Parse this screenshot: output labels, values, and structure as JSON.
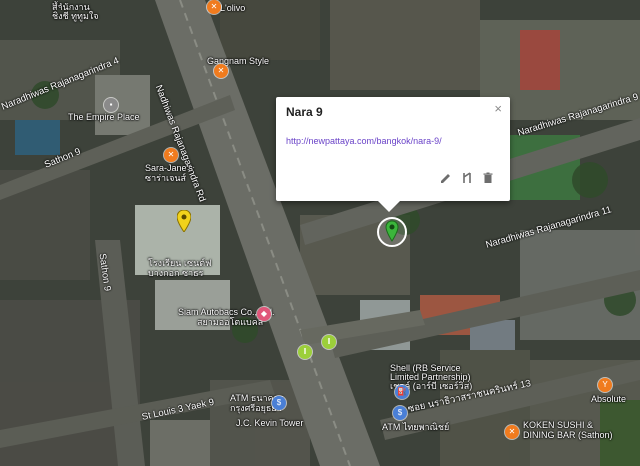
{
  "popup": {
    "title": "Nara 9",
    "link": "http://newpattaya.com/bangkok/nara-9/",
    "close": "×"
  },
  "roads": {
    "naradhiwas_main": "Nadhiwas Rajanagarindra Rd",
    "naradhiwas_4": "Naradhiwas Rajanagarindra 4",
    "naradhiwas_11": "Naradhiwas Rajanagarindra 11",
    "naradhiwas_alley": "Naradhiwas Rajanagarindra 9 Alley",
    "sathon_9": "Sathon 9",
    "soi_9": "Sathon 9",
    "st_louis": "St Louis 3 Yaek 9",
    "thai_road": "ซอย นราธิวาสราชนครินทร์ 13"
  },
  "labels": {
    "top_left_thai_1": "มัง",
    "top_left_thai_2": "สำนักงาน",
    "top_left_thai_3": "ชิงชี ทูทูมใจ",
    "lolivo": "L'olivo",
    "gangnam": "Gangnam Style",
    "empire": "The Empire Place",
    "sara_janes": "Sara-Jane's",
    "sara_janes_th": "ซาร่าเจนส์",
    "school_th_1": "โรงเรียน เซนต์ฟ",
    "school_th_2": "บางกอก ซาธร",
    "siam_autobacs": "Siam Autobacs Co., Ltd.",
    "siam_autobacs_th": "สยามออโตแบคส์",
    "shell_1": "Shell (RB Service",
    "shell_2": "Limited Partnership)",
    "shell_th": "เชลล์ (อาร์บี เซอร์วิส)",
    "atm_1": "ATM ธนาคาร",
    "atm_1b": "กรุงศรีอยุธยา",
    "atm_2": "ATM ไทยพาณิชย์",
    "kevin": "J.C. Kevin Tower",
    "koken_1": "KOKEN SUSHI &",
    "koken_2": "DINING BAR (Sathon)",
    "absolute": "Absolute"
  },
  "colors": {
    "marker_green": "#3bb53b",
    "marker_yellow": "#f2d21b",
    "poi_orange": "#f07b1e",
    "poi_pink": "#e0567a",
    "poi_blue": "#4a7fd6"
  }
}
